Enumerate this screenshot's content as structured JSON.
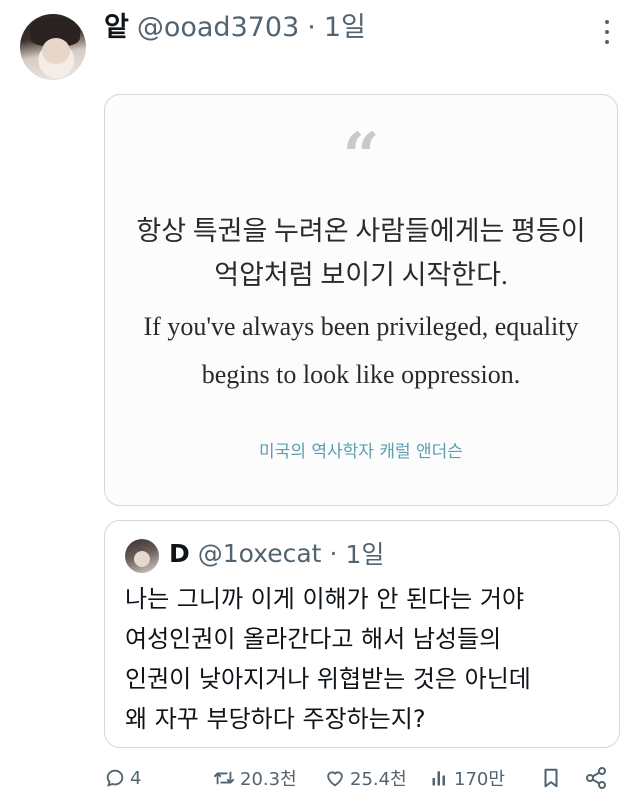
{
  "tweet": {
    "display_name": "앝",
    "handle": "@ooad3703",
    "separator": "·",
    "time": "1일"
  },
  "quote_card": {
    "quote_mark": "“",
    "korean_lines": [
      "항상 특권을 누려온 사람들에게는 평등이",
      "억압처럼 보이기 시작한다."
    ],
    "english_lines": [
      "If you've always been privileged, equality",
      "begins to look like oppression."
    ],
    "attribution": "미국의 역사학자 캐럴 앤더슨"
  },
  "quoted_tweet": {
    "display_name": "D",
    "handle": "@1oxecat",
    "separator": "·",
    "time": "1일",
    "lines": [
      "나는 그니까 이게 이해가 안 된다는 거야",
      "여성인권이 올라간다고 해서 남성들의",
      "인권이 낮아지거나 위협받는 것은 아닌데",
      "왜 자꾸 부당하다 주장하는지?"
    ]
  },
  "actions": {
    "replies": "4",
    "retweets": "20.3천",
    "likes": "25.4천",
    "views": "170만"
  },
  "icons": {
    "more": "more-icon",
    "reply": "reply-icon",
    "retweet": "retweet-icon",
    "like": "heart-icon",
    "views": "views-icon",
    "bookmark": "bookmark-icon",
    "share": "share-icon"
  },
  "colors": {
    "text": "#0f1419",
    "secondary": "#536471",
    "border": "#cfd9de",
    "attribution": "#5b9fb0"
  }
}
